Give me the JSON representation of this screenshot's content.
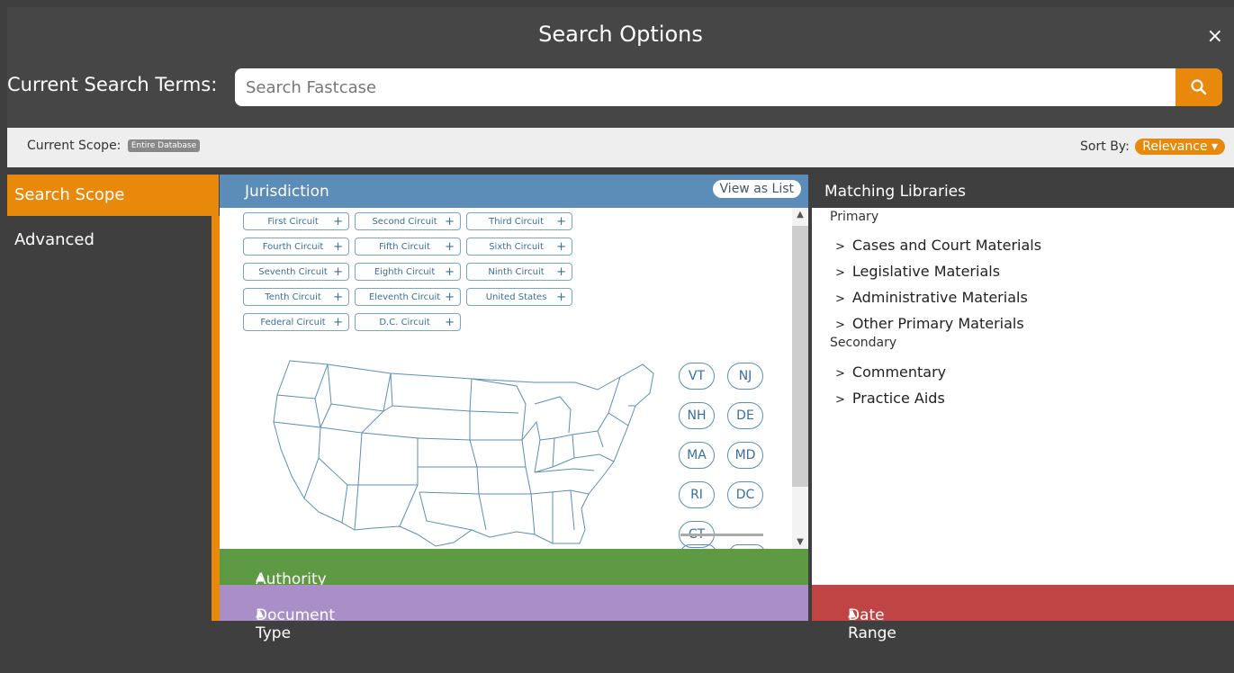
{
  "header": {
    "title": "Search Options",
    "close_glyph": "×",
    "search_terms_label": "Current Search Terms:",
    "search_placeholder": "Search Fastcase",
    "search_value": ""
  },
  "scope_bar": {
    "current_scope_label": "Current Scope:",
    "current_scope_badge": "Entire Database",
    "sort_label": "Sort By:",
    "sort_value": "Relevance ▾"
  },
  "left_nav": {
    "items": [
      {
        "label": "Search Scope",
        "active": true
      },
      {
        "label": "Advanced",
        "active": false
      }
    ]
  },
  "jurisdiction": {
    "title": "Jurisdiction",
    "view_as_list": "View as List",
    "circuits": [
      "First Circuit",
      "Second Circuit",
      "Third Circuit",
      "Fourth Circuit",
      "Fifth Circuit",
      "Sixth Circuit",
      "Seventh Circuit",
      "Eighth Circuit",
      "Ninth Circuit",
      "Tenth Circuit",
      "Eleventh Circuit",
      "United States",
      "Federal Circuit",
      "D.C. Circuit"
    ],
    "add_glyph": "+",
    "states": [
      "VT",
      "NJ",
      "NH",
      "DE",
      "MA",
      "MD",
      "RI",
      "DC",
      "CT"
    ]
  },
  "panels": {
    "authority_level": "Authority Level",
    "document_type": "Document Type",
    "date_range": "Date Range",
    "caret": "▲"
  },
  "matching_libraries": {
    "title": "Matching Libraries",
    "primary_label": "Primary",
    "primary_items": [
      "Cases and Court Materials",
      "Legislative Materials",
      "Administrative Materials",
      "Other Primary Materials"
    ],
    "secondary_label": "Secondary",
    "secondary_items": [
      "Commentary",
      "Practice Aids"
    ],
    "chevron": ">"
  },
  "colors": {
    "accent_orange": "#e8890c",
    "jurisdiction_blue": "#5b8db8",
    "authority_green": "#5e9a43",
    "document_purple": "#a98ec7",
    "date_red": "#c14444"
  },
  "icons": {
    "close": "close-icon",
    "search": "search-icon",
    "expand": "chevron-right-icon",
    "collapse": "caret-up-icon"
  }
}
